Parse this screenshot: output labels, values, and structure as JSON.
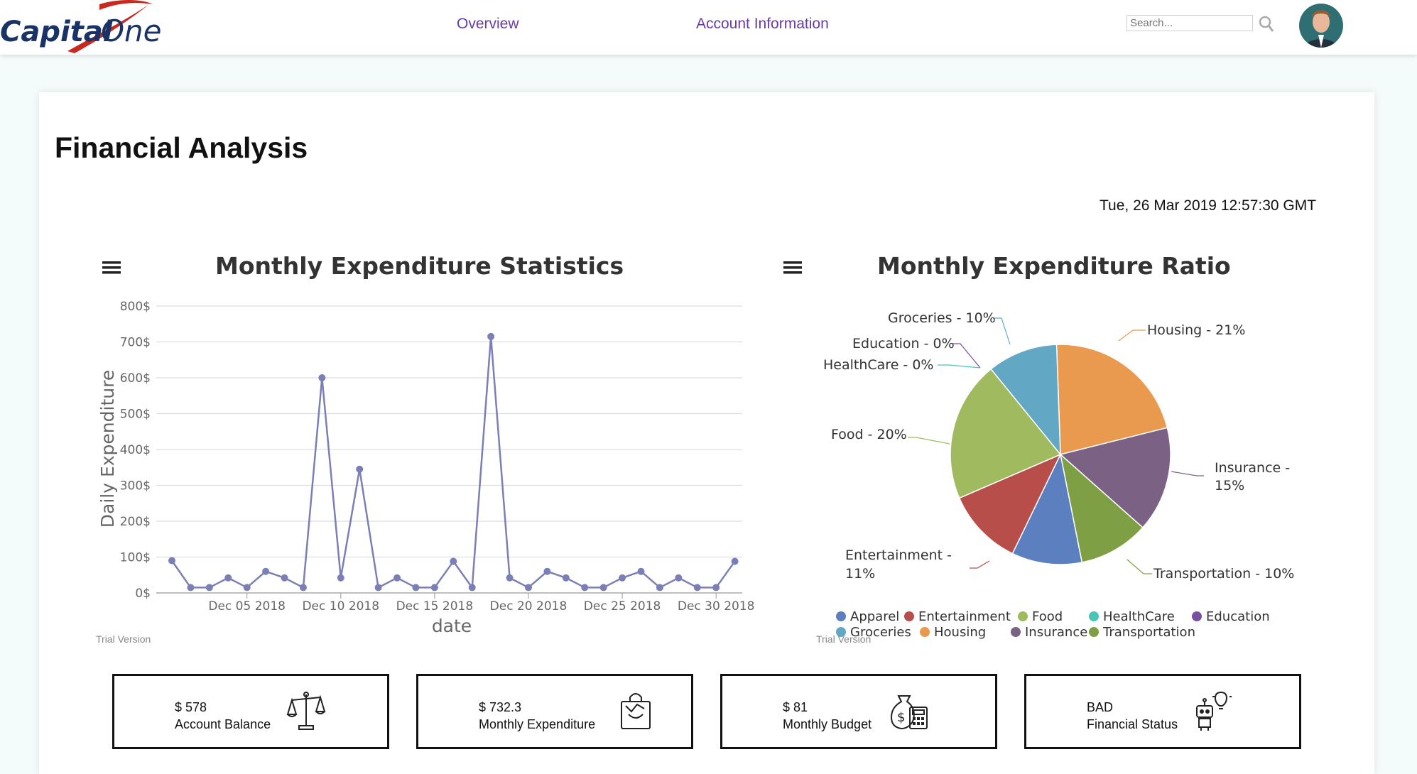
{
  "header": {
    "logo_text": "Capital One",
    "nav": [
      "Overview",
      "Account Information"
    ],
    "search_placeholder": "Search..."
  },
  "page": {
    "title": "Financial Analysis",
    "timestamp": "Tue, 26 Mar 2019 12:57:30 GMT"
  },
  "line_chart": {
    "title": "Monthly Expenditure Statistics",
    "ylabel": "Daily Expenditure",
    "xlabel": "date",
    "trial": "Trial Version",
    "y_ticks": [
      "0$",
      "100$",
      "200$",
      "300$",
      "400$",
      "500$",
      "600$",
      "700$",
      "800$"
    ],
    "x_ticks": [
      "Dec 05 2018",
      "Dec 10 2018",
      "Dec 15 2018",
      "Dec 20 2018",
      "Dec 25 2018",
      "Dec 30 2018"
    ]
  },
  "pie_chart": {
    "title": "Monthly Expenditure Ratio",
    "trial": "Trial Version",
    "labels": {
      "groceries": "Groceries - 10%",
      "education": "Education - 0%",
      "healthcare": "HealthCare - 0%",
      "food": "Food - 20%",
      "housing": "Housing - 21%",
      "insurance_1": "Insurance -",
      "insurance_2": "15%",
      "entertainment_1": "Entertainment -",
      "entertainment_2": "11%",
      "transportation": "Transportation - 10%"
    },
    "legend": [
      "Apparel",
      "Entertainment",
      "Food",
      "HealthCare",
      "Education",
      "Groceries",
      "Housing",
      "Insurance",
      "Transportation"
    ]
  },
  "chart_data": [
    {
      "type": "line",
      "title": "Monthly Expenditure Statistics",
      "xlabel": "date",
      "ylabel": "Daily Expenditure",
      "ylim": [
        0,
        800
      ],
      "x": [
        "Dec 01 2018",
        "Dec 02 2018",
        "Dec 03 2018",
        "Dec 04 2018",
        "Dec 05 2018",
        "Dec 06 2018",
        "Dec 07 2018",
        "Dec 08 2018",
        "Dec 09 2018",
        "Dec 10 2018",
        "Dec 11 2018",
        "Dec 12 2018",
        "Dec 13 2018",
        "Dec 14 2018",
        "Dec 15 2018",
        "Dec 16 2018",
        "Dec 17 2018",
        "Dec 18 2018",
        "Dec 19 2018",
        "Dec 20 2018",
        "Dec 21 2018",
        "Dec 22 2018",
        "Dec 23 2018",
        "Dec 24 2018",
        "Dec 25 2018",
        "Dec 26 2018",
        "Dec 27 2018",
        "Dec 28 2018",
        "Dec 29 2018",
        "Dec 30 2018",
        "Dec 31 2018"
      ],
      "series": [
        {
          "values": [
            90,
            15,
            15,
            42,
            15,
            60,
            42,
            15,
            600,
            42,
            345,
            15,
            42,
            15,
            15,
            88,
            15,
            715,
            42,
            15,
            60,
            42,
            15,
            15,
            42,
            60,
            15,
            42,
            15,
            15,
            88
          ]
        }
      ],
      "color": "#7b7fb5",
      "grid": true
    },
    {
      "type": "pie",
      "title": "Monthly Expenditure Ratio",
      "categories": [
        "Apparel",
        "Entertainment",
        "Food",
        "HealthCare",
        "Education",
        "Groceries",
        "Housing",
        "Insurance",
        "Transportation"
      ],
      "values": [
        10,
        11,
        20,
        0,
        0,
        10,
        21,
        15,
        10
      ],
      "colors": [
        "#5b7fbf",
        "#b84e4a",
        "#a0ba60",
        "#4cc3b8",
        "#7a4fa3",
        "#62a8c4",
        "#e99a4e",
        "#7b6284",
        "#7f9f44"
      ],
      "legend_position": "bottom"
    }
  ],
  "stats": [
    {
      "value": "$ 578",
      "label": "Account Balance",
      "icon": "scale-icon"
    },
    {
      "value": "$ 732.3",
      "label": "Monthly Expenditure",
      "icon": "shopping-bag-icon"
    },
    {
      "value": "$ 81",
      "label": "Monthly Budget",
      "icon": "money-bag-calculator-icon"
    },
    {
      "value": "BAD",
      "label": "Financial Status",
      "icon": "robot-lightbulb-icon"
    }
  ]
}
